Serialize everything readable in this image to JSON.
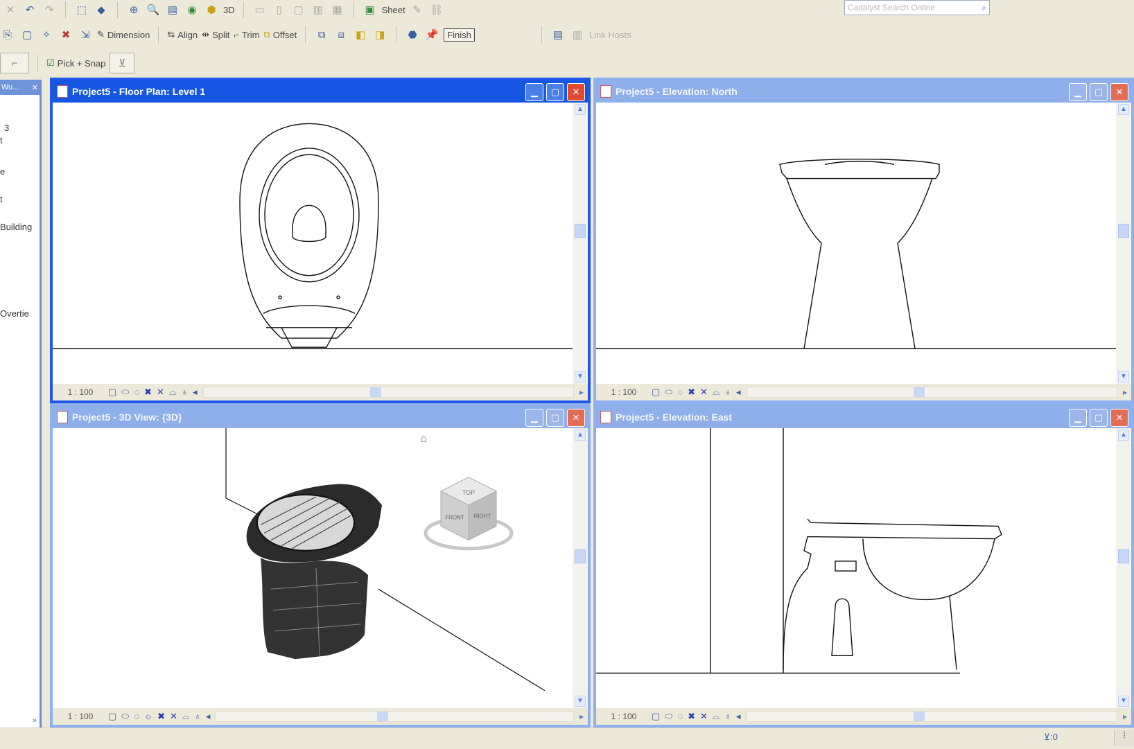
{
  "toolbar1": {
    "render3d_label": "3D",
    "sheet_label": "Sheet",
    "search": {
      "placeholder": "Cadalyst Search Online"
    }
  },
  "toolbar2": {
    "dimension_label": "Dimension",
    "align_label": "Align",
    "split_label": "Split",
    "trim_label": "Trim",
    "offset_label": "Offset",
    "boxed_label": "Finish",
    "disabled_label": "Link Hosts"
  },
  "toolbar3": {
    "joint_label": "Pick + Snap"
  },
  "browser": {
    "header": "Wu...",
    "items": [
      "3",
      "t",
      "e",
      "t",
      "Building",
      "Overtie"
    ]
  },
  "views": {
    "floor_plan": {
      "title": "Project5 - Floor Plan: Level 1",
      "scale": "1 : 100"
    },
    "elev_north": {
      "title": "Project5 - Elevation: North",
      "scale": "1 : 100"
    },
    "view3d": {
      "title": "Project5 - 3D View: {3D}",
      "scale": "1 : 100"
    },
    "elev_east": {
      "title": "Project5 - Elevation: East",
      "scale": "1 : 100"
    }
  },
  "viewcube": {
    "top": "TOP",
    "front": "FRONT",
    "right": "RIGHT"
  },
  "status": {
    "filter_count": "0"
  }
}
